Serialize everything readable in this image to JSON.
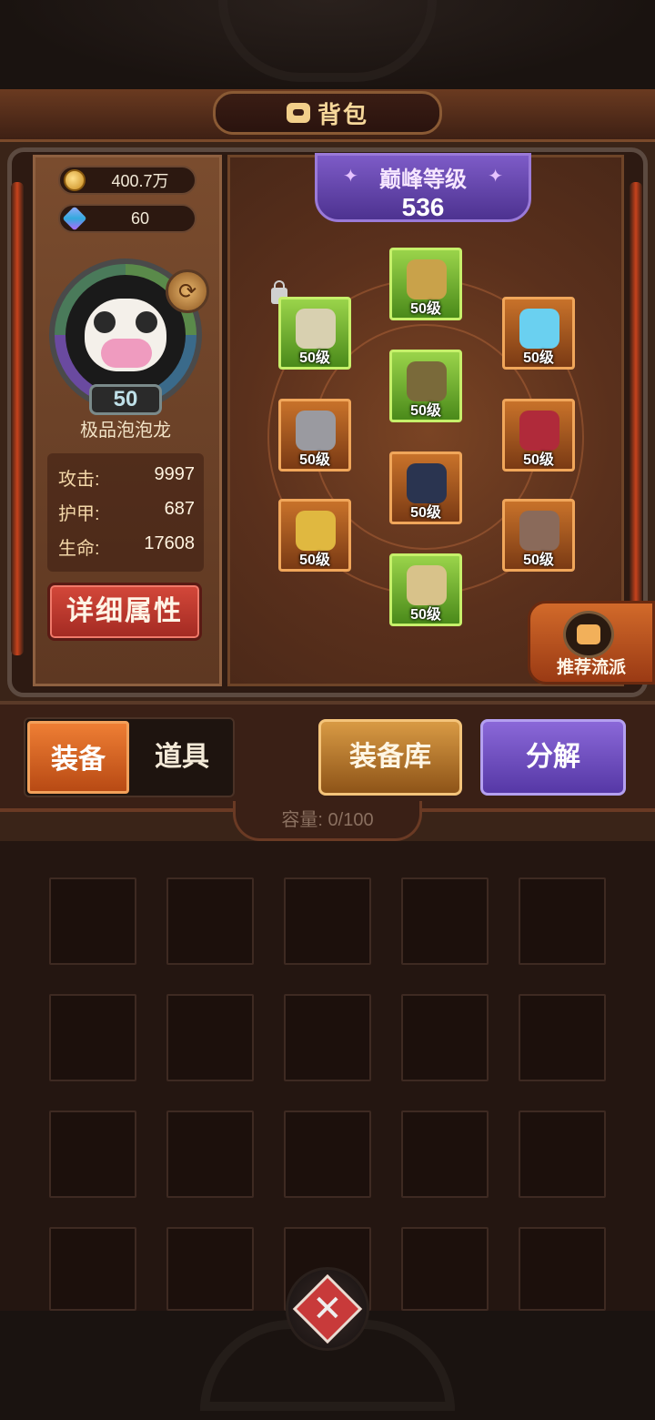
{
  "header": {
    "title": "背包",
    "title_icon": "bag-icon"
  },
  "currency": {
    "gold": {
      "icon": "coin-icon",
      "value": "400.7万"
    },
    "gems": {
      "icon": "gem-icon",
      "value": "60"
    }
  },
  "pet": {
    "level": "50",
    "name": "极品泡泡龙",
    "swap_icon": "refresh-icon"
  },
  "stats": [
    {
      "label": "攻击:",
      "value": "9997"
    },
    {
      "label": "护甲:",
      "value": "687"
    },
    {
      "label": "生命:",
      "value": "17608"
    }
  ],
  "detail_button": "详细属性",
  "peak": {
    "title": "巅峰等级",
    "value": "536"
  },
  "equipment": [
    {
      "slot": "helmet",
      "rarity": "green",
      "level": "50级",
      "icon": "antler-helmet-icon"
    },
    {
      "slot": "shoulder",
      "rarity": "green",
      "level": "50级",
      "icon": "shoulder-armor-icon",
      "locked": true
    },
    {
      "slot": "necklace",
      "rarity": "orange",
      "level": "50级",
      "icon": "necklace-icon"
    },
    {
      "slot": "chest",
      "rarity": "green",
      "level": "50级",
      "icon": "chest-armor-icon"
    },
    {
      "slot": "gloves",
      "rarity": "orange",
      "level": "50级",
      "icon": "gauntlet-icon"
    },
    {
      "slot": "ring",
      "rarity": "orange",
      "level": "50级",
      "icon": "ring-icon"
    },
    {
      "slot": "legs",
      "rarity": "orange",
      "level": "50级",
      "icon": "pants-icon"
    },
    {
      "slot": "weapon",
      "rarity": "orange",
      "level": "50级",
      "icon": "bow-icon"
    },
    {
      "slot": "quiver",
      "rarity": "orange",
      "level": "50级",
      "icon": "quiver-icon"
    },
    {
      "slot": "boots",
      "rarity": "green",
      "level": "50级",
      "icon": "boots-icon"
    }
  ],
  "recommend": {
    "label": "推荐流派",
    "icon": "thumbs-up-icon"
  },
  "tabs": {
    "equip": "装备",
    "items": "道具"
  },
  "buttons": {
    "library": "装备库",
    "decompose": "分解"
  },
  "capacity": "容量: 0/100",
  "close_icon": "close-icon",
  "colors": {
    "green_rarity": "#9ad44a",
    "orange_rarity": "#c8722a",
    "purple": "#5638a6",
    "red": "#a22a22"
  }
}
